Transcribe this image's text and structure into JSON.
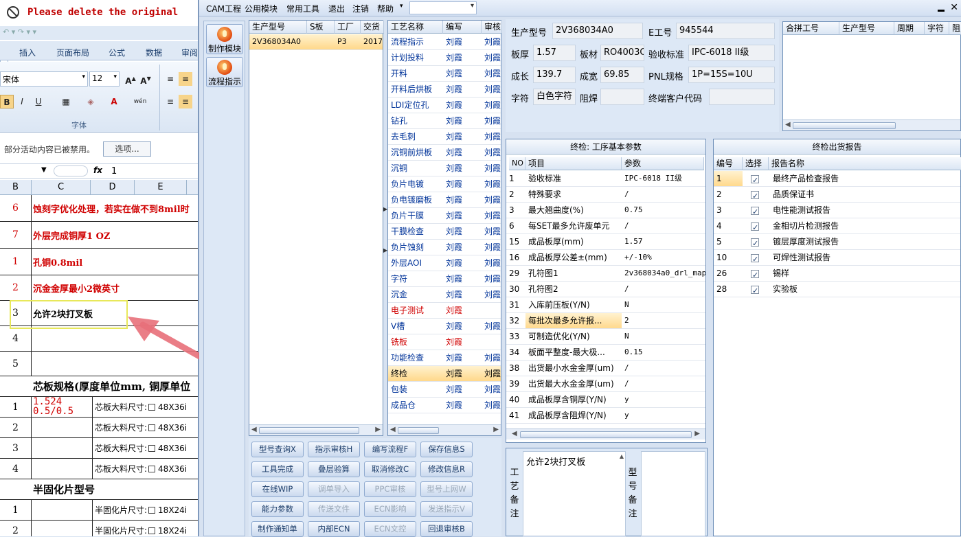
{
  "excel": {
    "title": "Please delete the original",
    "qat": "↶ ▾ ↷ ▾ ▾",
    "tabs": [
      "插入",
      "页面布局",
      "公式",
      "数据",
      "审阅"
    ],
    "font_name": "宋体",
    "font_size": "12",
    "font_group_label": "字体",
    "security_msg": "部分活动内容已被禁用。",
    "options_button": "选项...",
    "name_box": "",
    "formula_value": "1",
    "columns": [
      "B",
      "C",
      "D",
      "E"
    ],
    "rows": [
      {
        "n": "6",
        "text": "蚀刻字优化处理，若实在做不到8mil时",
        "red": true
      },
      {
        "n": "7",
        "text": "外层完成铜厚1 OZ",
        "red": true
      },
      {
        "n": "1",
        "text": "孔铜0.8mil",
        "red": true
      },
      {
        "n": "2",
        "text": "沉金金厚最小2微英寸",
        "red": true
      },
      {
        "n": "3",
        "text": "允许2块打叉板",
        "red": false
      },
      {
        "n": "4",
        "text": "",
        "red": false
      },
      {
        "n": "5",
        "text": "",
        "red": false
      }
    ],
    "core_header": "芯板规格(厚度单位mm, 铜厚单位",
    "core_header_red": "mm",
    "core_rows": [
      {
        "n": "1",
        "val": "1.524",
        "val2": "0.5/0.5",
        "label": "芯板大料尺寸:",
        "opt": "48X36i"
      },
      {
        "n": "2",
        "val": "",
        "label": "芯板大料尺寸:",
        "opt": "48X36i"
      },
      {
        "n": "3",
        "val": "",
        "label": "芯板大料尺寸:",
        "opt": "48X36i"
      },
      {
        "n": "4",
        "val": "",
        "label": "芯板大料尺寸:",
        "opt": "48X36i"
      }
    ],
    "pp_header": "半固化片型号",
    "pp_rows": [
      {
        "n": "1",
        "label": "半固化片尺寸:",
        "opt": "18X24i"
      },
      {
        "n": "2",
        "label": "半固化片尺寸:",
        "opt": "18X24i"
      }
    ]
  },
  "app": {
    "menu": [
      "CAM工程",
      "公用模块",
      "常用工具",
      "退出",
      "注销",
      "帮助"
    ],
    "nav": [
      "制作模块",
      "流程指示"
    ],
    "orders": {
      "headers": [
        "生产型号",
        "S板",
        "工厂",
        "交货"
      ],
      "rows": [
        [
          "2V368034A0",
          "",
          "P3",
          "2017"
        ]
      ]
    },
    "process": {
      "headers": [
        "工艺名称",
        "编写",
        "审核"
      ],
      "rows": [
        {
          "name": "流程指示",
          "writer": "刘霞",
          "reviewer": "刘霞",
          "red": false
        },
        {
          "name": "计划投料",
          "writer": "刘霞",
          "reviewer": "刘霞",
          "red": false
        },
        {
          "name": "开料",
          "writer": "刘霞",
          "reviewer": "刘霞",
          "red": false
        },
        {
          "name": "开料后烘板",
          "writer": "刘霞",
          "reviewer": "刘霞",
          "red": false
        },
        {
          "name": "LDI定位孔",
          "writer": "刘霞",
          "reviewer": "刘霞",
          "red": false
        },
        {
          "name": "钻孔",
          "writer": "刘霞",
          "reviewer": "刘霞",
          "red": false
        },
        {
          "name": "去毛刺",
          "writer": "刘霞",
          "reviewer": "刘霞",
          "red": false
        },
        {
          "name": "沉铜前烘板",
          "writer": "刘霞",
          "reviewer": "刘霞",
          "red": false
        },
        {
          "name": "沉铜",
          "writer": "刘霞",
          "reviewer": "刘霞",
          "red": false
        },
        {
          "name": "负片电镀",
          "writer": "刘霞",
          "reviewer": "刘霞",
          "red": false
        },
        {
          "name": "负电镀磨板",
          "writer": "刘霞",
          "reviewer": "刘霞",
          "red": false
        },
        {
          "name": "负片干膜",
          "writer": "刘霞",
          "reviewer": "刘霞",
          "red": false
        },
        {
          "name": "干膜检查",
          "writer": "刘霞",
          "reviewer": "刘霞",
          "red": false
        },
        {
          "name": "负片蚀刻",
          "writer": "刘霞",
          "reviewer": "刘霞",
          "red": false
        },
        {
          "name": "外层AOI",
          "writer": "刘霞",
          "reviewer": "刘霞",
          "red": false
        },
        {
          "name": "字符",
          "writer": "刘霞",
          "reviewer": "刘霞",
          "red": false
        },
        {
          "name": "沉金",
          "writer": "刘霞",
          "reviewer": "刘霞",
          "red": false
        },
        {
          "name": "电子测试",
          "writer": "刘霞",
          "reviewer": "",
          "red": true
        },
        {
          "name": "V槽",
          "writer": "刘霞",
          "reviewer": "刘霞",
          "red": false
        },
        {
          "name": "铣板",
          "writer": "刘霞",
          "reviewer": "",
          "red": true
        },
        {
          "name": "功能检查",
          "writer": "刘霞",
          "reviewer": "刘霞",
          "red": false
        },
        {
          "name": "终检",
          "writer": "刘霞",
          "reviewer": "刘霞",
          "red": false,
          "selected": true
        },
        {
          "name": "包装",
          "writer": "刘霞",
          "reviewer": "刘霞",
          "red": false
        },
        {
          "name": "成品仓",
          "writer": "刘霞",
          "reviewer": "刘霞",
          "red": false
        }
      ]
    },
    "buttons": [
      [
        {
          "label": "型号查询X",
          "dis": false
        },
        {
          "label": "指示审核H",
          "dis": false
        },
        {
          "label": "编写流程F",
          "dis": false
        },
        {
          "label": "保存信息S",
          "dis": false
        }
      ],
      [
        {
          "label": "工具完成",
          "dis": false
        },
        {
          "label": "叠层验算",
          "dis": false
        },
        {
          "label": "取消修改C",
          "dis": false
        },
        {
          "label": "修改信息R",
          "dis": false
        }
      ],
      [
        {
          "label": "在线WIP",
          "dis": false
        },
        {
          "label": "调单导入",
          "dis": true
        },
        {
          "label": "PPC审核",
          "dis": true
        },
        {
          "label": "型号上网W",
          "dis": true
        }
      ],
      [
        {
          "label": "能力参数",
          "dis": false
        },
        {
          "label": "传送文件",
          "dis": true
        },
        {
          "label": "ECN影响",
          "dis": true
        },
        {
          "label": "发送指示V",
          "dis": true
        }
      ],
      [
        {
          "label": "制作通知单",
          "dis": false
        },
        {
          "label": "内部ECN",
          "dis": false
        },
        {
          "label": "ECN文控",
          "dis": true
        },
        {
          "label": "回退审核B",
          "dis": false
        }
      ]
    ],
    "info": {
      "model_label": "生产型号",
      "model": "2V368034A0",
      "e_label": "E工号",
      "e_no": "945544",
      "thick_label": "板厚",
      "thick": "1.57",
      "mat_label": "板材",
      "mat": "RO4003C",
      "std_label": "验收标准",
      "std": "IPC-6018 II级",
      "len_label": "成长",
      "len": "139.7",
      "wid_label": "成宽",
      "wid": "69.85",
      "pnl_label": "PNL规格",
      "pnl": "1P=15S=10U",
      "char_label": "字符",
      "char": "白色字符",
      "mask_label": "阻焊",
      "mask": "",
      "cust_label": "终端客户代码",
      "cust": ""
    },
    "merge": {
      "headers": [
        "合拼工号",
        "生产型号",
        "周期",
        "字符",
        "阻"
      ]
    },
    "params": {
      "title": "终检: 工序基本参数",
      "headers": [
        "NO",
        "项目",
        "参数"
      ],
      "rows": [
        [
          "1",
          "验收标准",
          "IPC-6018 II级"
        ],
        [
          "2",
          "特殊要求",
          "/"
        ],
        [
          "3",
          "最大翘曲度(%)",
          "0.75"
        ],
        [
          "6",
          "每SET最多允许废单元",
          "/"
        ],
        [
          "15",
          "成品板厚(mm)",
          "1.57"
        ],
        [
          "16",
          "成品板厚公差±(mm)",
          "+/-10%"
        ],
        [
          "29",
          "孔符图1",
          "2v368034a0_drl_map"
        ],
        [
          "30",
          "孔符图2",
          "/"
        ],
        [
          "31",
          "入库前压板(Y/N)",
          "N"
        ],
        [
          "32",
          "每批次最多允许报...",
          "2"
        ],
        [
          "33",
          "可制造优化(Y/N)",
          "N"
        ],
        [
          "34",
          "板面平整度-最大极...",
          "0.15"
        ],
        [
          "38",
          "出货最小水金金厚(um)",
          "/"
        ],
        [
          "39",
          "出货最大水金金厚(um)",
          "/"
        ],
        [
          "40",
          "成品板厚含铜厚(Y/N)",
          "y"
        ],
        [
          "41",
          "成品板厚含阻焊(Y/N)",
          "y"
        ]
      ],
      "selected_index": 9
    },
    "reports": {
      "title": "终检出货报告",
      "headers": [
        "编号",
        "选择",
        "报告名称"
      ],
      "rows": [
        [
          "1",
          "最终产品检查报告"
        ],
        [
          "2",
          "品质保证书"
        ],
        [
          "3",
          "电性能测试报告"
        ],
        [
          "4",
          "金相切片检测报告"
        ],
        [
          "5",
          "镀层厚度测试报告"
        ],
        [
          "10",
          "可焊性测试报告"
        ],
        [
          "26",
          "锡样"
        ],
        [
          "28",
          "实验板"
        ]
      ]
    },
    "notes": {
      "process_label": "工艺备注",
      "process_text": "允许2块打叉板",
      "model_label": "型号备注",
      "model_text": ""
    }
  },
  "colors": {
    "accent": "#ffd88a",
    "highlight": "#e8e85a",
    "arrow": "#e8707a"
  }
}
